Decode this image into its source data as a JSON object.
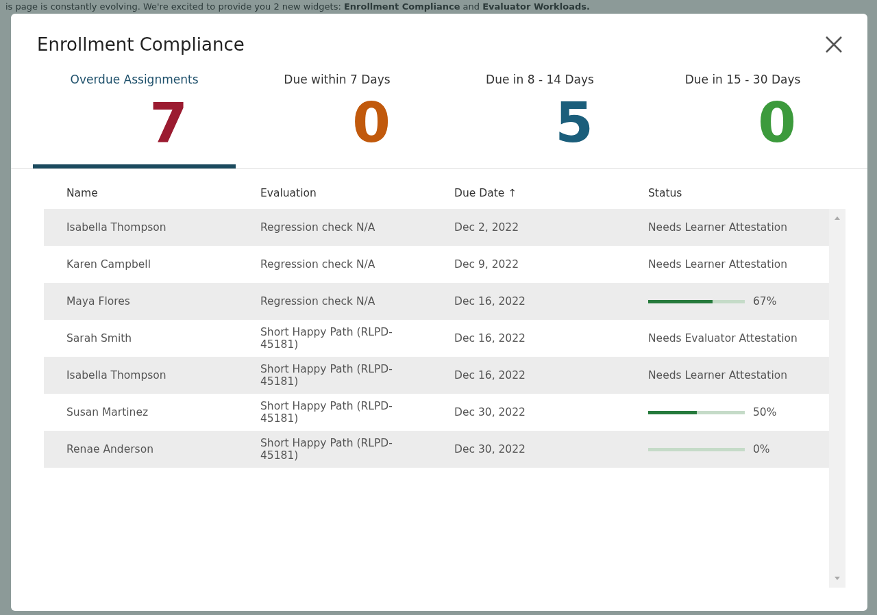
{
  "background_notice": "is page is constantly evolving. We're excited to provide you 2 new widgets: **Enrollment Compliance** and **Evaluator Workloads.**",
  "dialog": {
    "title": "Enrollment Compliance",
    "tabs": [
      {
        "label": "Overdue Assignments",
        "count": "7",
        "color": "#9b1b30",
        "selected": true
      },
      {
        "label": "Due within 7 Days",
        "count": "0",
        "color": "#c1590c",
        "selected": false
      },
      {
        "label": "Due in 8 - 14 Days",
        "count": "5",
        "color": "#1b5e7b",
        "selected": false
      },
      {
        "label": "Due in 15 - 30 Days",
        "count": "0",
        "color": "#3c9a3c",
        "selected": false
      }
    ],
    "table": {
      "columns": [
        "Name",
        "Evaluation",
        "Due Date ↑",
        "Status"
      ],
      "rows": [
        {
          "name": "Isabella Thompson",
          "evaluation": "Regression check N/A",
          "due_date": "Dec 2, 2022",
          "status": {
            "kind": "text",
            "text": "Needs Learner Attestation"
          }
        },
        {
          "name": "Karen Campbell",
          "evaluation": "Regression check N/A",
          "due_date": "Dec 9, 2022",
          "status": {
            "kind": "text",
            "text": "Needs Learner Attestation"
          }
        },
        {
          "name": "Maya Flores",
          "evaluation": "Regression check N/A",
          "due_date": "Dec 16, 2022",
          "status": {
            "kind": "progress",
            "level": 0.67,
            "text": "67%"
          }
        },
        {
          "name": "Sarah Smith",
          "evaluation": "Short Happy Path (RLPD-45181)",
          "due_date": "Dec 16, 2022",
          "status": {
            "kind": "text",
            "text": "Needs Evaluator Attestation"
          }
        },
        {
          "name": "Isabella Thompson",
          "evaluation": "Short Happy Path (RLPD-45181)",
          "due_date": "Dec 16, 2022",
          "status": {
            "kind": "text",
            "text": "Needs Learner Attestation"
          }
        },
        {
          "name": "Susan Martinez",
          "evaluation": "Short Happy Path (RLPD-45181)",
          "due_date": "Dec 30, 2022",
          "status": {
            "kind": "progress",
            "level": 0.5,
            "text": "50%"
          }
        },
        {
          "name": "Renae Anderson",
          "evaluation": "Short Happy Path (RLPD-45181)",
          "due_date": "Dec 30, 2022",
          "status": {
            "kind": "progress",
            "text": "0%"
          }
        }
      ]
    }
  }
}
